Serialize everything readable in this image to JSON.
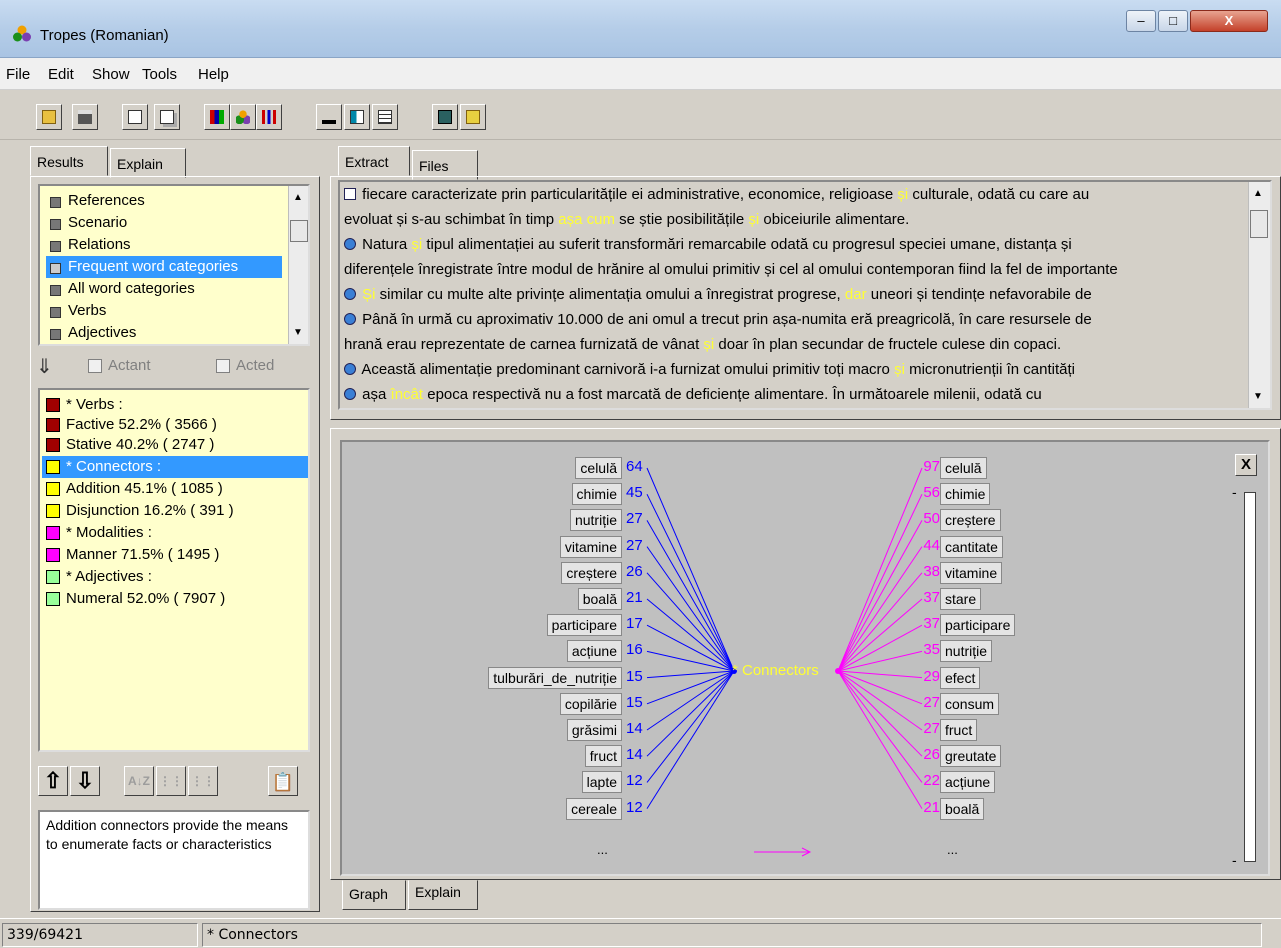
{
  "window": {
    "title": "Tropes (Romanian)",
    "minimize": "–",
    "maximize": "□",
    "close": "X"
  },
  "menu": [
    "File",
    "Edit",
    "Show",
    "Tools",
    "Help"
  ],
  "toolbar": [
    "open-icon",
    "print-icon",
    "properties-icon",
    "copy-icon",
    "grid-icon",
    "actors-icon",
    "bars-icon",
    "chart-icon",
    "columns-icon",
    "table-icon",
    "book-icon",
    "notes-icon"
  ],
  "left_tabs": [
    "Results",
    "Explain"
  ],
  "results_list": [
    {
      "label": "References",
      "selected": false
    },
    {
      "label": "Scenario",
      "selected": false
    },
    {
      "label": "Relations",
      "selected": false
    },
    {
      "label": "Frequent word categories",
      "selected": true
    },
    {
      "label": "All word categories",
      "selected": false
    },
    {
      "label": "Verbs",
      "selected": false
    },
    {
      "label": "Adjectives",
      "selected": false
    }
  ],
  "checks": {
    "actant": "Actant",
    "acted": "Acted"
  },
  "stats": [
    {
      "label": "* Verbs :",
      "color": "#a00000",
      "selected": false
    },
    {
      "label": "Factive  52.2% ( 3566 )",
      "color": "#a00000",
      "selected": false
    },
    {
      "label": "Stative  40.2% ( 2747 )",
      "color": "#a00000",
      "selected": false
    },
    {
      "label": "* Connectors :",
      "color": "#ffff00",
      "selected": true
    },
    {
      "label": "Addition  45.1% ( 1085 )",
      "color": "#ffff00",
      "selected": false
    },
    {
      "label": "Disjunction  16.2% ( 391 )",
      "color": "#ffff00",
      "selected": false
    },
    {
      "label": "* Modalities :",
      "color": "#ff00ff",
      "selected": false
    },
    {
      "label": "Manner  71.5% ( 1495 )",
      "color": "#ff00ff",
      "selected": false
    },
    {
      "label": "* Adjectives :",
      "color": "#99ff99",
      "selected": false
    },
    {
      "label": "Numeral  52.0% ( 7907 )",
      "color": "#99ff99",
      "selected": false
    }
  ],
  "description": "Addition connectors provide the means to enumerate facts or characteristics",
  "right_tabs": [
    "Extract",
    "Files"
  ],
  "extract_lines": [
    [
      {
        "t": " fiecare caracterizate prin particularitățile ei administrative, economice, religioase "
      },
      {
        "t": "și",
        "h": 1
      },
      {
        "t": " culturale,  odată cu care au"
      }
    ],
    [
      {
        "t": "evoluat și s-au schimbat în timp "
      },
      {
        "t": "așa cum",
        "h": 1
      },
      {
        "t": " se știe posibilitățile "
      },
      {
        "t": "și",
        "h": 1
      },
      {
        "t": " obiceiurile alimentare."
      }
    ],
    [
      {
        "t": " Natura "
      },
      {
        "t": "și",
        "h": 1
      },
      {
        "t": " tipul alimentației au suferit transformări remarcabile odată cu progresul speciei umane,  distanța și"
      }
    ],
    [
      {
        "t": "diferențele înregistrate între modul de hrănire al omului primitiv și cel al omului contemporan fiind la fel de importante"
      }
    ],
    [
      {
        "t": " "
      },
      {
        "t": "Și",
        "h": 1
      },
      {
        "t": " similar cu multe alte privințe alimentația omului a înregistrat progrese,  "
      },
      {
        "t": "dar",
        "h": 1
      },
      {
        "t": " uneori și tendințe nefavorabile de"
      }
    ],
    [
      {
        "t": " Până în urmă cu aproximativ 10.000 de ani omul a trecut prin așa-numita eră preagricolă, în care resursele de"
      }
    ],
    [
      {
        "t": "hrană erau reprezentate de carnea furnizată de vânat "
      },
      {
        "t": "și",
        "h": 1
      },
      {
        "t": " doar în plan secundar de fructele culese din copaci."
      }
    ],
    [
      {
        "t": " Această alimentație predominant carnivoră i-a furnizat omului primitiv toți macro "
      },
      {
        "t": "și",
        "h": 1
      },
      {
        "t": " micronutrienții în cantități"
      }
    ],
    [
      {
        "t": "  așa "
      },
      {
        "t": "încât",
        "h": 1
      },
      {
        "t": " epoca respectivă nu a fost marcată de deficiențe alimentare. În următoarele milenii, odată cu"
      }
    ]
  ],
  "graph": {
    "hub": "* Connectors",
    "left": [
      {
        "word": "celulă",
        "n": "64"
      },
      {
        "word": "chimie",
        "n": "45"
      },
      {
        "word": "nutriție",
        "n": "27"
      },
      {
        "word": "vitamine",
        "n": "27"
      },
      {
        "word": "creștere",
        "n": "26"
      },
      {
        "word": "boală",
        "n": "21"
      },
      {
        "word": "participare",
        "n": "17"
      },
      {
        "word": "acțiune",
        "n": "16"
      },
      {
        "word": "tulburări_de_nutriție",
        "n": "15"
      },
      {
        "word": "copilărie",
        "n": "15"
      },
      {
        "word": "grăsimi",
        "n": "14"
      },
      {
        "word": "fruct",
        "n": "14"
      },
      {
        "word": "lapte",
        "n": "12"
      },
      {
        "word": "cereale",
        "n": "12"
      }
    ],
    "right": [
      {
        "word": "celulă",
        "n": "97"
      },
      {
        "word": "chimie",
        "n": "56"
      },
      {
        "word": "creștere",
        "n": "50"
      },
      {
        "word": "cantitate",
        "n": "44"
      },
      {
        "word": "vitamine",
        "n": "38"
      },
      {
        "word": "stare",
        "n": "37"
      },
      {
        "word": "participare",
        "n": "37"
      },
      {
        "word": "nutriție",
        "n": "35"
      },
      {
        "word": "efect",
        "n": "29"
      },
      {
        "word": "consum",
        "n": "27"
      },
      {
        "word": "fruct",
        "n": "27"
      },
      {
        "word": "greutate",
        "n": "26"
      },
      {
        "word": "acțiune",
        "n": "22"
      },
      {
        "word": "boală",
        "n": "21"
      }
    ],
    "more": "...",
    "close": "X"
  },
  "graph_tabs": [
    "Graph",
    "Explain"
  ],
  "status": {
    "position": "339/69421",
    "selection": "* Connectors"
  }
}
